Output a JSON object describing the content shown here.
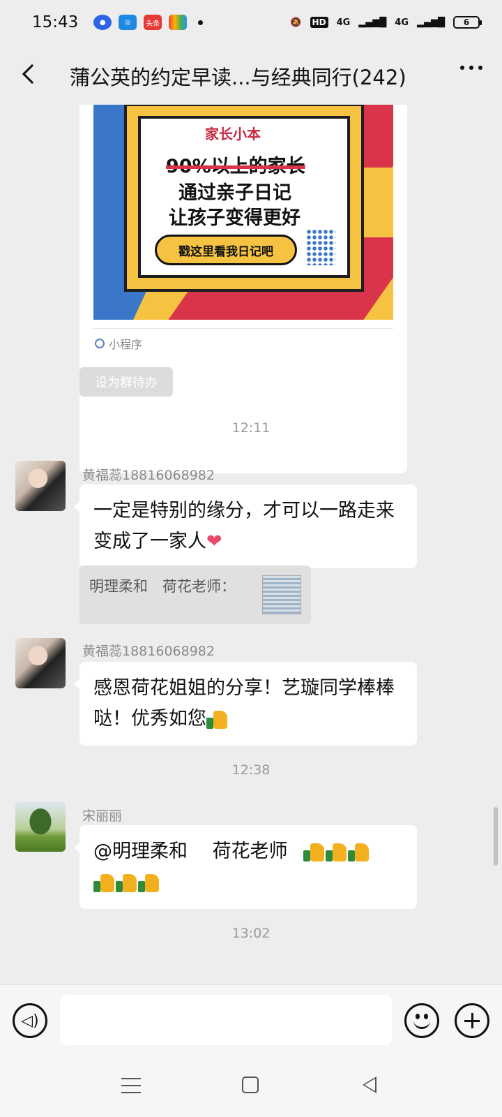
{
  "status_bar": {
    "time": "15:43",
    "apps": [
      "baidu-app-icon",
      "360-app-icon",
      "toutiao-app-icon",
      "wallet-app-icon"
    ],
    "toutiao_label": "头条",
    "network": "4G",
    "hd_label": "HD",
    "battery": "6"
  },
  "header": {
    "title": "蒲公英的约定早读...与经典同行(242)"
  },
  "card": {
    "brand": "家长小本",
    "line1": "90%以上的家长",
    "line2": "通过亲子日记",
    "line3": "让孩子变得更好",
    "cta": "戳这里看我日记吧",
    "footer": "小程序"
  },
  "todo_button": "设为群待办",
  "timestamps": [
    "12:11",
    "12:38",
    "13:02"
  ],
  "messages": [
    {
      "sender": "黄福蕊18816068982",
      "text": "一定是特别的缘分，才可以一路走来变成了一家人",
      "emoji": "❤",
      "quote": "明理柔和　荷花老师："
    },
    {
      "sender": "黄福蕊18816068982",
      "text": "感恩荷花姐姐的分享！艺璇同学棒棒哒！优秀如您"
    },
    {
      "sender": "宋丽丽",
      "text": "@明理柔和　 荷花老师"
    }
  ],
  "input": {
    "placeholder": ""
  },
  "colors": {
    "background": "#ededed",
    "bubble": "#ffffff",
    "heart": "#e8486a",
    "card_yellow": "#f5c242",
    "card_blue": "#3b77c9",
    "card_red": "#d9344a"
  }
}
